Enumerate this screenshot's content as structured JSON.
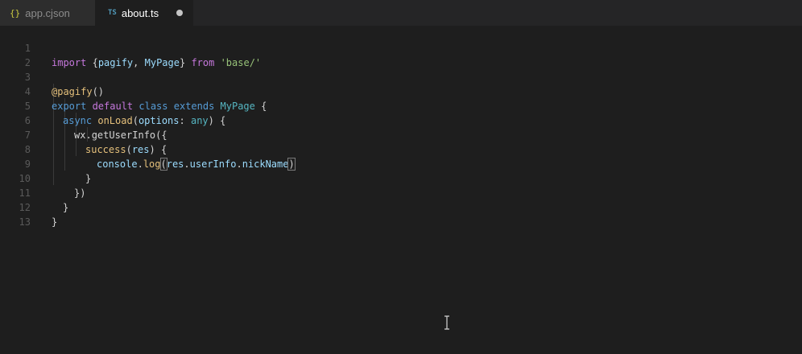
{
  "tabs": [
    {
      "icon": "{}",
      "label": "app.cjson"
    },
    {
      "icon": "TS",
      "label": "about.ts"
    }
  ],
  "line_numbers": [
    "1",
    "2",
    "3",
    "4",
    "5",
    "6",
    "7",
    "8",
    "9",
    "10",
    "11",
    "12",
    "13"
  ],
  "code": {
    "l1": {
      "import": "import",
      "brace_open": " {",
      "pagify": "pagify",
      "comma": ", ",
      "mypage": "MyPage",
      "brace_close": "} ",
      "from": "from",
      "space": " ",
      "path": "'base/'"
    },
    "l3": {
      "decorator": "@pagify",
      "parens": "()"
    },
    "l4": {
      "export": "export",
      "default": " default",
      "class": " class",
      "extends": " extends",
      "mypage": " MyPage",
      "brace": " {"
    },
    "l5": {
      "async": "async",
      "onload": " onLoad",
      "open": "(",
      "options": "options",
      "colon": ": ",
      "any": "any",
      "close": ") {"
    },
    "l6": {
      "wx": "wx",
      "dot": ".",
      "getuserinfo": "getUserInfo",
      "open": "({"
    },
    "l7": {
      "success": "success",
      "open": "(",
      "res": "res",
      "close": ") {"
    },
    "l8": {
      "console": "console",
      "dot": ".",
      "log": "log",
      "open": "(",
      "res": "res",
      "dot2": ".",
      "userinfo": "userInfo",
      "dot3": ".",
      "nickname": "nickName",
      "close": ")"
    },
    "l9": {
      "brace": "}"
    },
    "l10": {
      "close": "})"
    },
    "l11": {
      "brace": "}"
    },
    "l12": {
      "brace": "}"
    }
  }
}
